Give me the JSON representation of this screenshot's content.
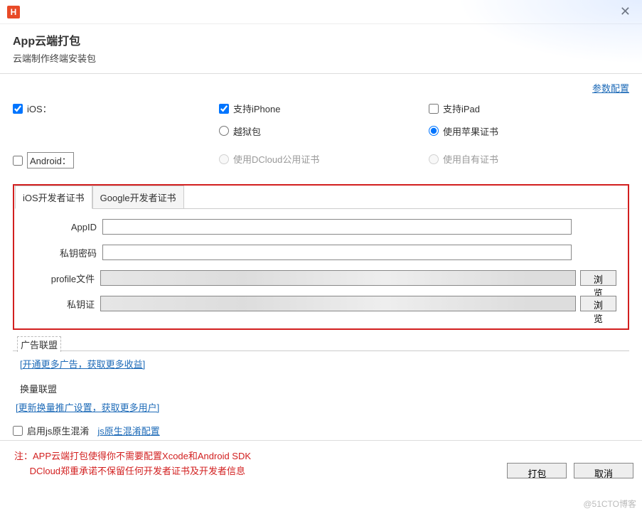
{
  "titlebar": {
    "logo_letter": "H"
  },
  "header": {
    "title": "App云端打包",
    "subtitle": "云端制作终端安装包"
  },
  "top_link": "参数配置",
  "platforms": {
    "ios_label": "iOS：",
    "android_label": "Android：",
    "support_iphone": "支持iPhone",
    "support_ipad": "支持iPad",
    "jailbreak": "越狱包",
    "use_apple_cert": "使用苹果证书",
    "dcloud_cert": "使用DCloud公用证书",
    "own_cert": "使用自有证书"
  },
  "tabs": {
    "ios": "iOS开发者证书",
    "google": "Google开发者证书"
  },
  "form": {
    "appid_label": "AppID",
    "key_pwd_label": "私钥密码",
    "profile_label": "profile文件",
    "cert_label": "私钥证",
    "browse": "浏览"
  },
  "ad_section": {
    "title": "广告联盟",
    "link": "[开通更多广告，获取更多收益]"
  },
  "exchange_section": {
    "title": "换量联盟",
    "link": "[更新换量推广设置，获取更多用户]"
  },
  "js_mix": {
    "checkbox_label": "启用js原生混淆",
    "link": "js原生混淆配置"
  },
  "footer": {
    "note_prefix": "注：",
    "note_line1": "APP云端打包使得你不需要配置Xcode和Android SDK",
    "note_line2": "DCloud郑重承诺不保留任何开发者证书及开发者信息",
    "pack_btn": "打包",
    "cancel_btn": "取消"
  },
  "watermark": "@51CTO博客"
}
